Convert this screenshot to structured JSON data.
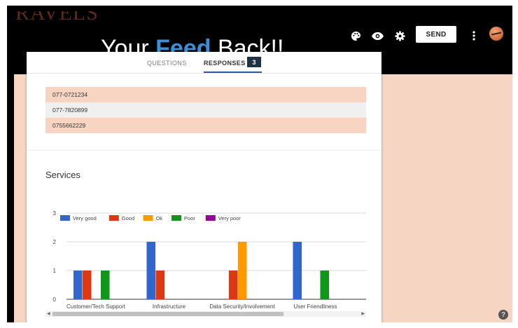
{
  "brand": {
    "partial_text": "RAVELS"
  },
  "hero": {
    "title_pre": "Your ",
    "title_accent": "Feed",
    "title_post": " Back!!"
  },
  "header": {
    "send_label": "SEND",
    "icons": [
      "palette-icon",
      "eye-icon",
      "gear-icon",
      "more-vert-icon"
    ]
  },
  "tabs": {
    "questions_label": "QUESTIONS",
    "responses_label": "RESPONSES",
    "responses_count": "3"
  },
  "responses": [
    "077-0721234",
    "077-7820899",
    "0755662229"
  ],
  "services": {
    "title": "Services"
  },
  "chart_data": {
    "type": "bar",
    "categories": [
      "Customer/Tech Support",
      "Infrastructure",
      "Data Security/Involvement",
      "User Friendliness"
    ],
    "series": [
      {
        "name": "Very good",
        "color": "#3366cc",
        "values": [
          1,
          2,
          0,
          2
        ]
      },
      {
        "name": "Good",
        "color": "#dc3912",
        "values": [
          1,
          1,
          1,
          0
        ]
      },
      {
        "name": "Ok",
        "color": "#ff9900",
        "values": [
          0,
          0,
          2,
          0
        ]
      },
      {
        "name": "Poor",
        "color": "#109618",
        "values": [
          1,
          0,
          0,
          1
        ]
      },
      {
        "name": "Very poor",
        "color": "#990099",
        "values": [
          0,
          0,
          0,
          0
        ]
      }
    ],
    "ylim": [
      0,
      3
    ],
    "yticks": [
      "0",
      "1",
      "2",
      "3"
    ],
    "grid": true,
    "legend_position": "top"
  }
}
